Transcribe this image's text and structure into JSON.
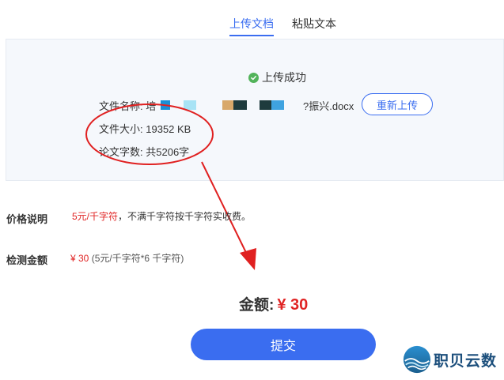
{
  "tabs": [
    {
      "label": "上传文档",
      "active": true
    },
    {
      "label": "粘贴文本",
      "active": false
    }
  ],
  "upload": {
    "status_text": "上传成功",
    "file_label": "文件名称:",
    "file_name_start": "培",
    "file_name_end": "?振兴.docx",
    "size_label": "文件大小:",
    "size_value": "19352 KB",
    "words_label": "论文字数:",
    "words_value": "共5206字",
    "reupload_label": "重新上传"
  },
  "price": {
    "label": "价格说明",
    "rate": "5元/千字符",
    "note": "，不满千字符按千字符实收费。"
  },
  "amount": {
    "label": "检测金额",
    "value": "¥ 30",
    "detail": "(5元/千字符*6 千字符)"
  },
  "total": {
    "label": "金额:",
    "value": "¥ 30"
  },
  "submit_label": "提交",
  "watermark": "职贝云数",
  "colors": {
    "accent": "#3a6df0",
    "price_red": "#e02424",
    "success": "#52b35a",
    "annotation": "#e02020"
  }
}
